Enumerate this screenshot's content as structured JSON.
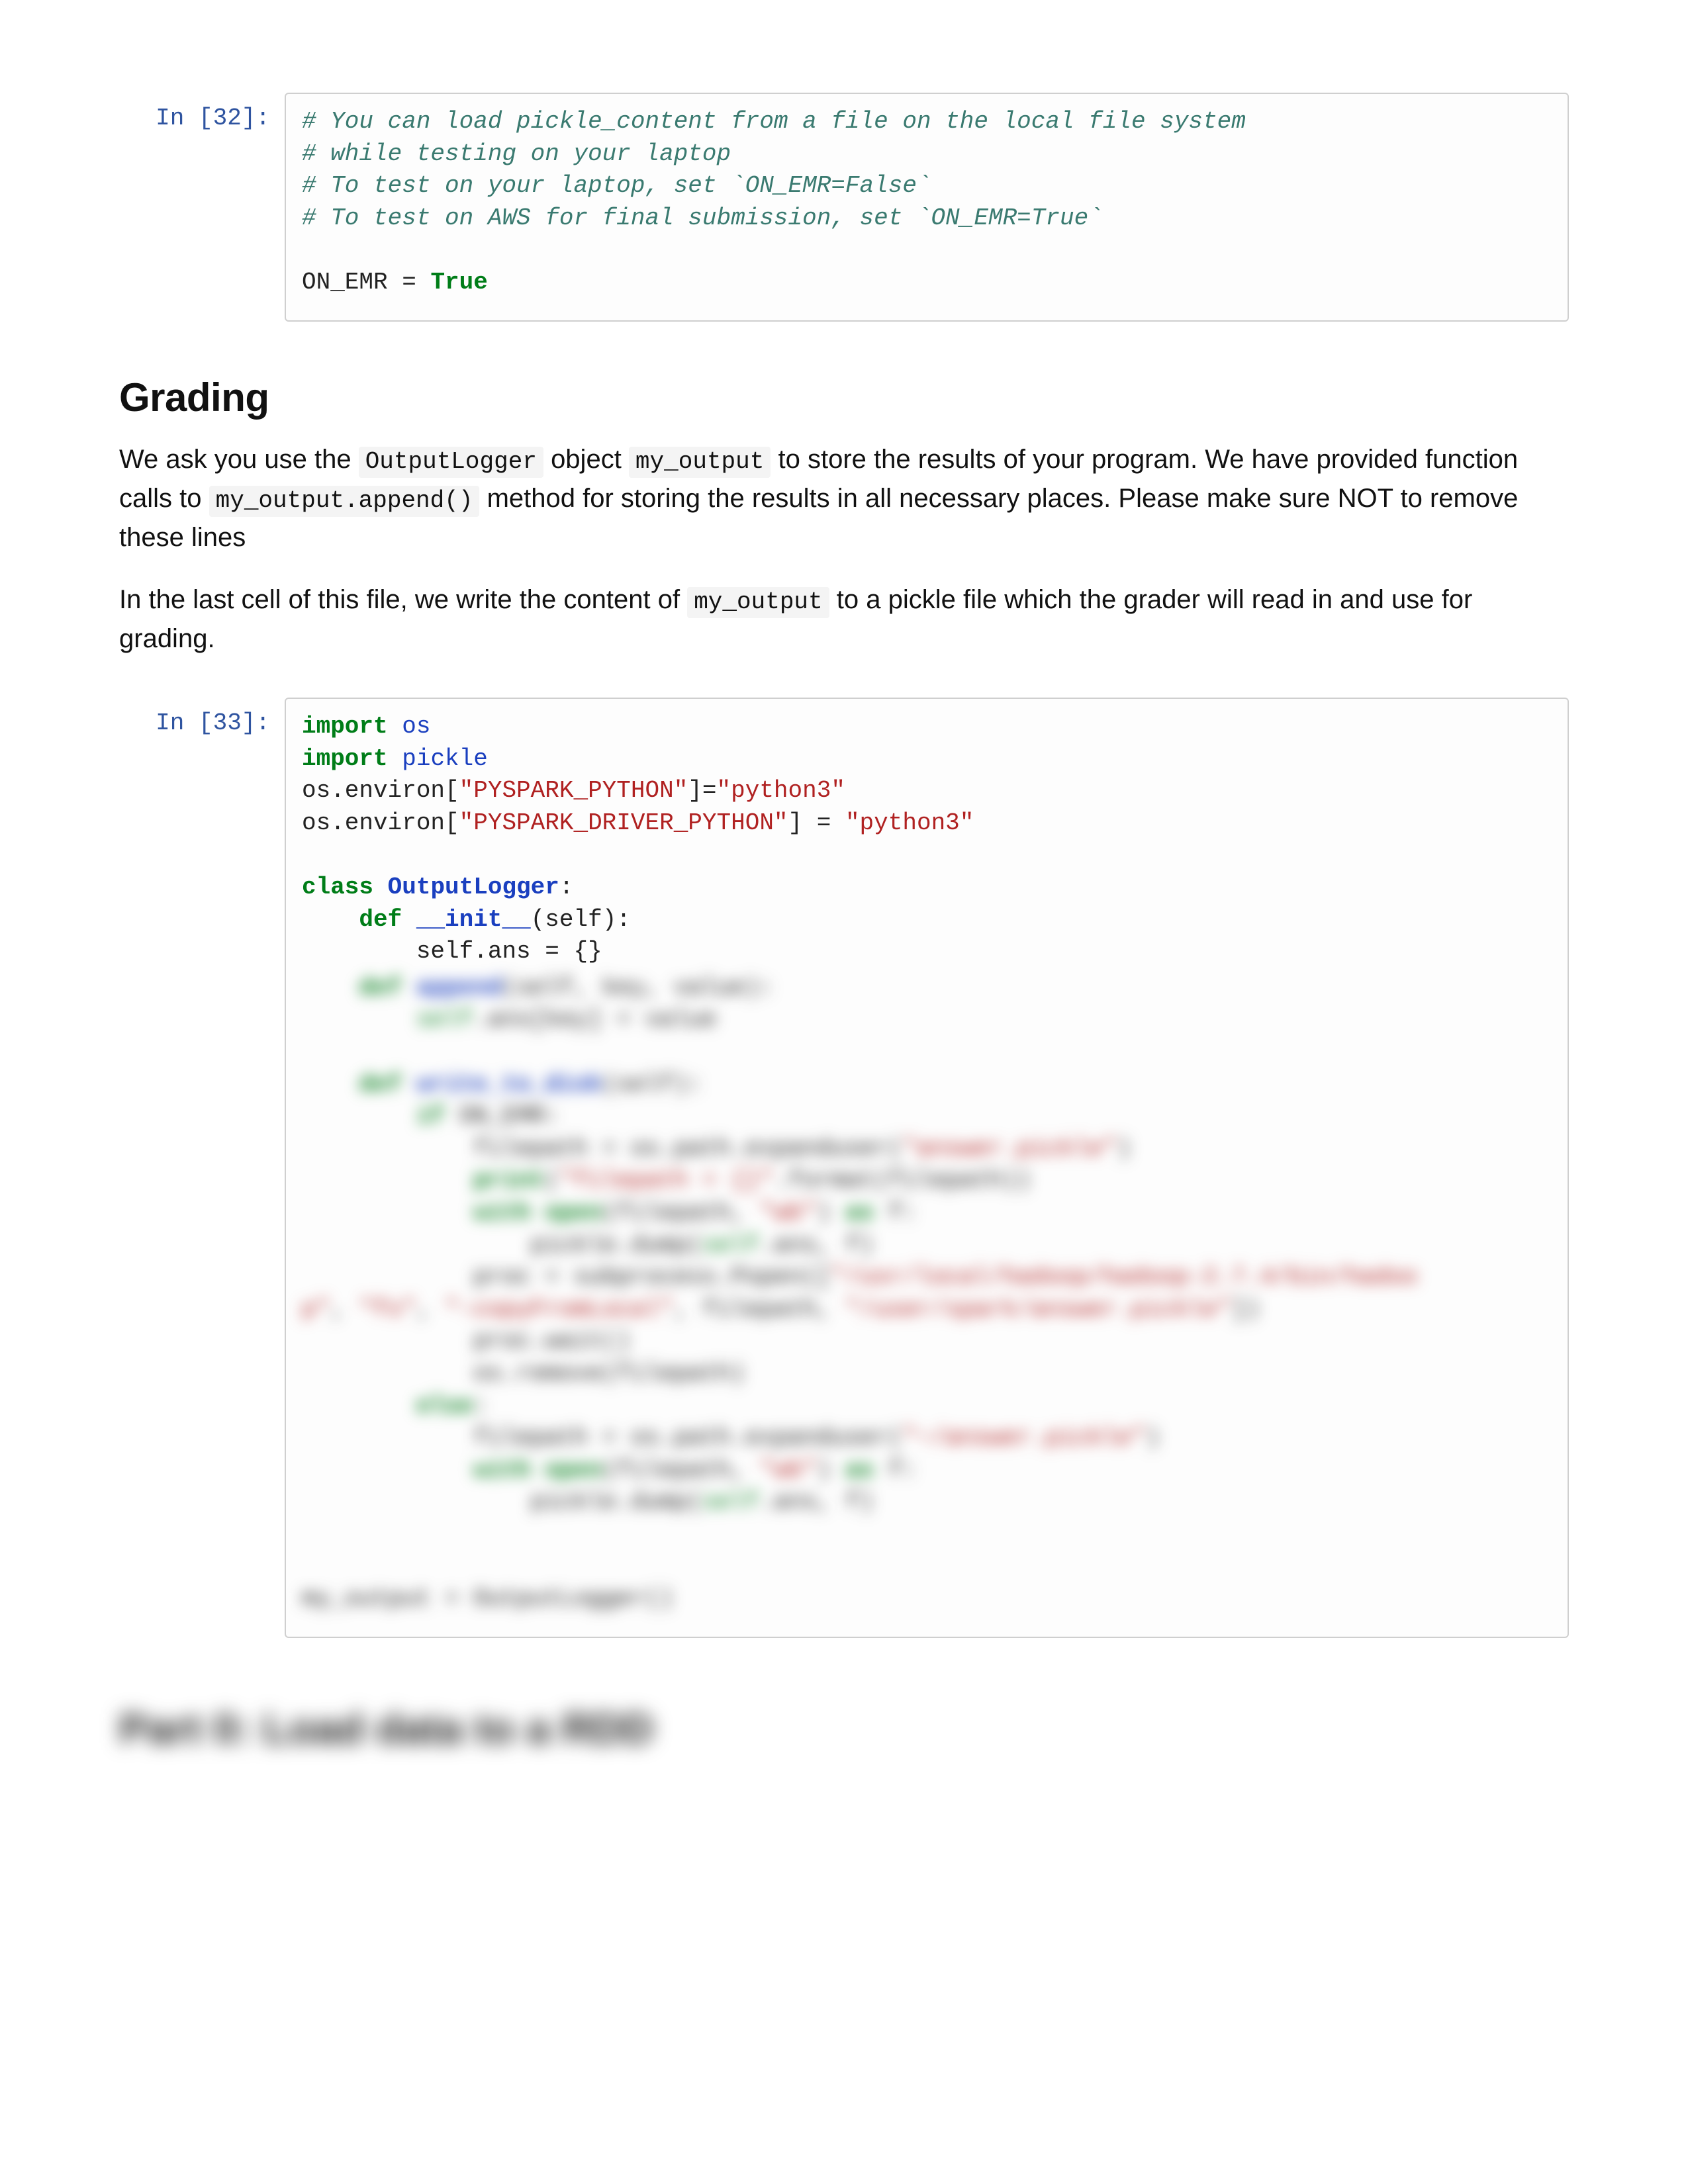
{
  "cell1": {
    "prompt": "In [32]:",
    "comment_l1": "# You can load pickle_content from a file on the local file system",
    "comment_l2": "# while testing on your laptop",
    "comment_l3": "# To test on your laptop, set `ON_EMR=False`",
    "comment_l4": "# To test on AWS for final submission, set `ON_EMR=True`",
    "assign_lhs": "ON_EMR = ",
    "assign_rhs": "True"
  },
  "grading": {
    "heading": "Grading",
    "p1_a": "We ask you use the ",
    "p1_code1": "OutputLogger",
    "p1_b": " object ",
    "p1_code2": "my_output",
    "p1_c": " to store the results of your program. We have provided function calls to ",
    "p1_code3": "my_output.append()",
    "p1_d": " method for storing the results in all necessary places. Please make sure NOT to remove these lines",
    "p2_a": "In the last cell of this file, we write the content of ",
    "p2_code1": "my_output",
    "p2_b": " to a pickle file which the grader will read in and use for grading."
  },
  "cell2": {
    "prompt": "In [33]:",
    "l1_kw": "import",
    "l1_mod": "os",
    "l2_kw": "import",
    "l2_mod": "pickle",
    "l3_a": "os.environ[",
    "l3_s": "\"PYSPARK_PYTHON\"",
    "l3_b": "]=",
    "l3_v": "\"python3\"",
    "l4_a": "os.environ[",
    "l4_s": "\"PYSPARK_DRIVER_PYTHON\"",
    "l4_b": "] = ",
    "l4_v": "\"python3\"",
    "l6_kw": "class",
    "l6_name": "OutputLogger",
    "l6_colon": ":",
    "l7_kw": "def",
    "l7_name": "__init__",
    "l7_sig": "(self):",
    "l8": "self.ans = {}"
  },
  "blurred_heading": "Part 0: Load data to a RDD"
}
